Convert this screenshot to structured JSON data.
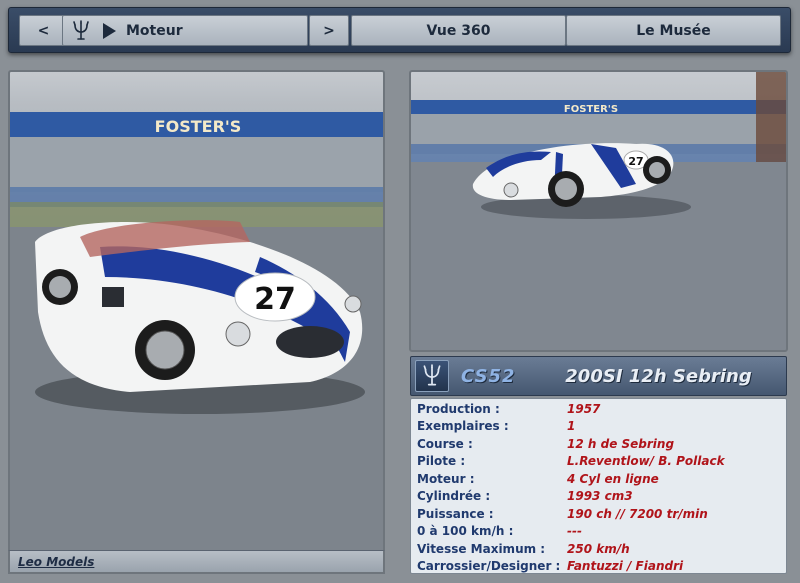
{
  "nav": {
    "prev_label": "<",
    "current_label": "Moteur",
    "next_label": ">",
    "view360_label": "Vue 360",
    "museum_label": "Le Musée"
  },
  "photo_left": {
    "caption": "Leo Models",
    "banner_text": "FOSTER'S",
    "car_number": "27"
  },
  "photo_right": {
    "banner_text": "FOSTER'S",
    "car_number": "27"
  },
  "title_bar": {
    "code": "CS52",
    "model": "200SI 12h Sebring"
  },
  "specs": [
    {
      "label": "Production :",
      "value": "1957"
    },
    {
      "label": "Exemplaires :",
      "value": "1"
    },
    {
      "label": "Course :",
      "value": "12 h de Sebring"
    },
    {
      "label": "Pilote :",
      "value": "L.Reventlow/ B. Pollack"
    },
    {
      "label": "Moteur :",
      "value": "4 Cyl en ligne"
    },
    {
      "label": "Cylindrée :",
      "value": "1993 cm3"
    },
    {
      "label": "Puissance :",
      "value": "190 ch // 7200 tr/min"
    },
    {
      "label": "0 à 100 km/h :",
      "value": "---"
    },
    {
      "label": "Vitesse Maximum :",
      "value": "250 km/h"
    },
    {
      "label": "Carrossier/Designer :",
      "value": "Fantuzzi / Fiandri"
    }
  ],
  "icons": {
    "brand_logo": "maserati-trident-icon",
    "play": "play-icon"
  },
  "colors": {
    "nav_bg": "#2f4059",
    "spec_label": "#203a6e",
    "spec_value": "#b0141a",
    "title_code": "#8fb3e4",
    "car_stripe": "#1f3c9c"
  }
}
